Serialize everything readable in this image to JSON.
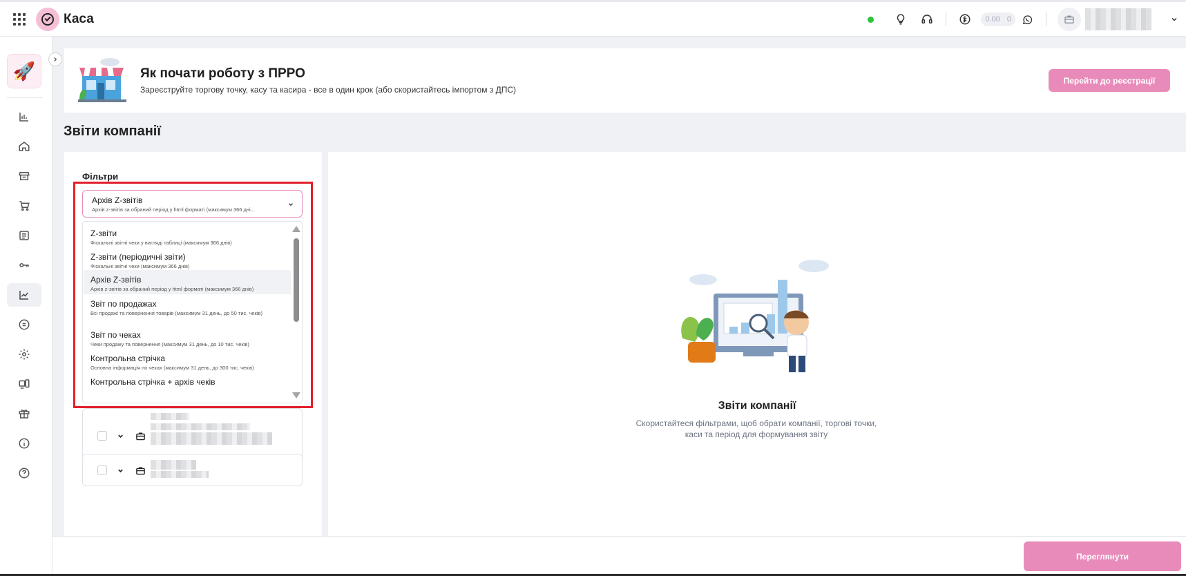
{
  "header": {
    "app_title": "Каса",
    "balance": {
      "amount": "0.00",
      "count": "0"
    },
    "icons": [
      "apps-grid-icon",
      "logo-check-icon",
      "status-online-dot",
      "tip-lightbulb-icon",
      "support-headset-icon",
      "currency-icon",
      "whatsapp-icon",
      "briefcase-icon",
      "chevron-down-icon"
    ]
  },
  "sidebar": {
    "items": [
      {
        "name": "rocket",
        "icon": "rocket-icon"
      },
      {
        "name": "analytics",
        "icon": "bar-chart-icon"
      },
      {
        "name": "home",
        "icon": "home-icon"
      },
      {
        "name": "store",
        "icon": "store-icon"
      },
      {
        "name": "cart",
        "icon": "cart-icon"
      },
      {
        "name": "receipts",
        "icon": "receipt-icon"
      },
      {
        "name": "keys",
        "icon": "key-icon"
      },
      {
        "name": "reports",
        "icon": "trend-chart-icon",
        "active": true
      },
      {
        "name": "currency",
        "icon": "currency-icon"
      },
      {
        "name": "settings",
        "icon": "gear-icon"
      },
      {
        "name": "devices",
        "icon": "devices-icon"
      },
      {
        "name": "gift",
        "icon": "gift-icon"
      },
      {
        "name": "info",
        "icon": "info-icon"
      },
      {
        "name": "help",
        "icon": "help-icon"
      }
    ]
  },
  "banner": {
    "title": "Як почати роботу з ПРРО",
    "subtitle": "Зареєструйте торгову точку, касу та касира - все в один крок (або скористайтесь імпортом з ДПС)",
    "button": "Перейти до реєстрації"
  },
  "page": {
    "title": "Звіти компанії"
  },
  "filters": {
    "label": "Фільтри",
    "selected": {
      "title": "Архів Z-звітів",
      "desc": "Архів z-звітів за обраний період у html форматі (максимум 366 дні..."
    },
    "options": [
      {
        "title": "Z-звіти",
        "desc": "Фіскальні звітні чеки у вигляді таблиці (максимум 366 днів)"
      },
      {
        "title": "Z-звіти (періодичні звіти)",
        "desc": "Фіскальні звітні чеки (максимум 366 днів)"
      },
      {
        "title": "Архів Z-звітів",
        "desc": "Архів z-звітів за обраний період у html форматі (максимум 366 днів)",
        "selected": true
      },
      {
        "title": "Звіт по продажах",
        "desc": "Всі продажі та повернення товарів (максимум 31 день, до 50 тис. чеків)"
      },
      {
        "title": "Звіт по чеках",
        "desc": "Чеки продажу та повернення (максимум 31 день, до 10 тис. чеків)"
      },
      {
        "title": "Контрольна стрічка",
        "desc": "Основна інформація по чеках (максимум 31 день, до 300 тис. чеків)"
      },
      {
        "title": "Контрольна стрічка + архів чеків",
        "desc": ""
      }
    ]
  },
  "empty_state": {
    "title": "Звіти компанії",
    "subtitle": "Скористайтеся фільтрами, щоб обрати компанії, торгові точки, каси та період для формування звіту"
  },
  "footer": {
    "button": "Переглянути"
  },
  "colors": {
    "accent": "#e98bba",
    "highlight": "#e2202b",
    "online": "#2ec63b"
  }
}
